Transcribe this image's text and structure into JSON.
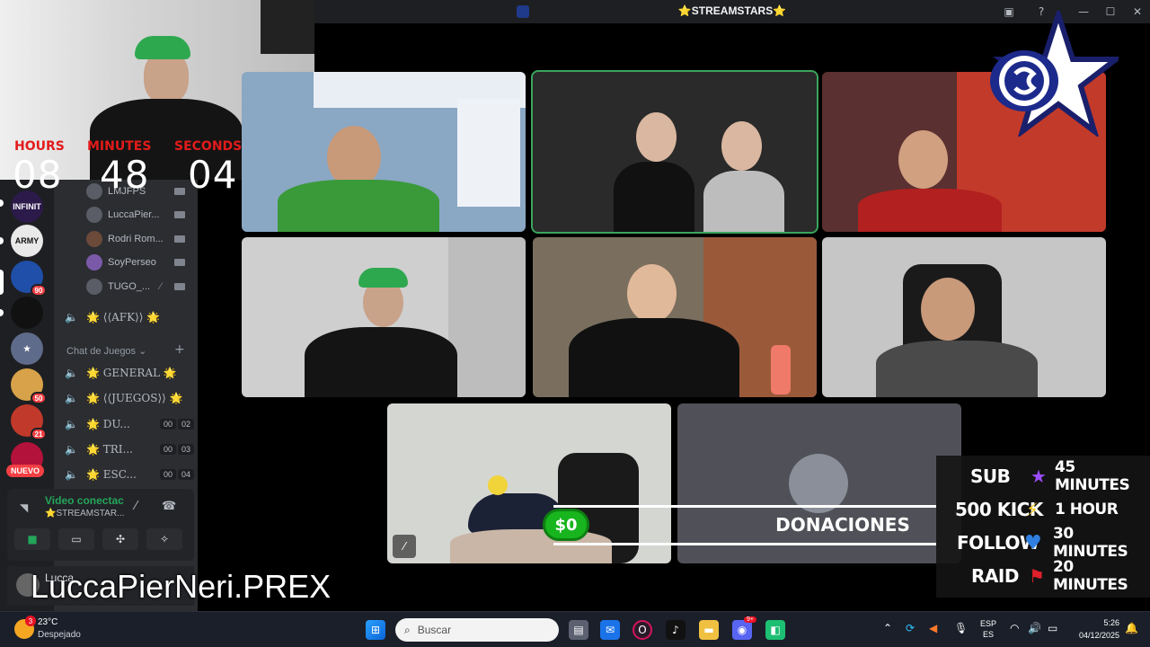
{
  "window": {
    "title": "⭐STREAMSTARS⭐"
  },
  "timer": {
    "hours_label": "HOURS",
    "minutes_label": "MINUTES",
    "seconds_label": "SECONDS",
    "hours": "08",
    "minutes": "48",
    "seconds": "04"
  },
  "rail": {
    "icons": [
      {
        "label": "INFINIT",
        "color": "#2b1a4a"
      },
      {
        "label": "ARMY",
        "color": "#e9e9e9"
      },
      {
        "label": "",
        "color": "#1f4fa8",
        "badge": "90"
      },
      {
        "label": "",
        "color": "#111111"
      },
      {
        "label": "",
        "color": "#5f6b8a"
      },
      {
        "label": "",
        "color": "#d8a24a",
        "badge": "50"
      },
      {
        "label": "",
        "color": "#c0392b",
        "badge": "21"
      },
      {
        "label": "",
        "color": "#b3123a"
      }
    ],
    "new_badge": "NUEVO"
  },
  "voice_users": [
    {
      "name": "LMJFPS"
    },
    {
      "name": "LuccaPier..."
    },
    {
      "name": "Rodri Rom..."
    },
    {
      "name": "SoyPerseo"
    },
    {
      "name": "TUGO_..."
    }
  ],
  "channels": {
    "afk": "🌟 ⟨⟨AFK⟩⟩ 🌟",
    "category": "Chat de Juegos",
    "list": [
      {
        "name": "🌟 GENERAL 🌟"
      },
      {
        "name": "🌟 ⟨⟨JUEGOS⟩⟩ 🌟"
      },
      {
        "name": "🌟 DU...",
        "tag1": "00",
        "tag2": "02"
      },
      {
        "name": "🌟 TRI...",
        "tag1": "00",
        "tag2": "03"
      },
      {
        "name": "🌟 ESC...",
        "tag1": "00",
        "tag2": "04"
      }
    ]
  },
  "voice_panel": {
    "status": "Video conectac",
    "channel": "⭐STREAMSTAR..."
  },
  "user": {
    "name": "Lucca"
  },
  "overlay_name": "LuccaPierNeri.PREX",
  "donations": {
    "amount": "$0",
    "label": "DONACIONES"
  },
  "goals": [
    {
      "key": "SUB",
      "icon": "★",
      "icon_color": "#9b4dff",
      "value": "45 MINUTES"
    },
    {
      "key": "500 KICK",
      "icon": "⚡",
      "icon_color": "#f5c518",
      "value": "1 HOUR"
    },
    {
      "key": "FOLLOW",
      "icon": "♥",
      "icon_color": "#2f7fe0",
      "value": "30 MINUTES"
    },
    {
      "key": "RAID",
      "icon": "⚑",
      "icon_color": "#e0202a",
      "value": "20 MINUTES"
    }
  ],
  "taskbar": {
    "weather_temp": "23°C",
    "weather_desc": "Despejado",
    "weather_badge": "3",
    "search_placeholder": "Buscar",
    "discord_badge": "9+",
    "lang": "ESP",
    "lang2": "ES",
    "time": "5:26",
    "date": "04/12/2025"
  }
}
